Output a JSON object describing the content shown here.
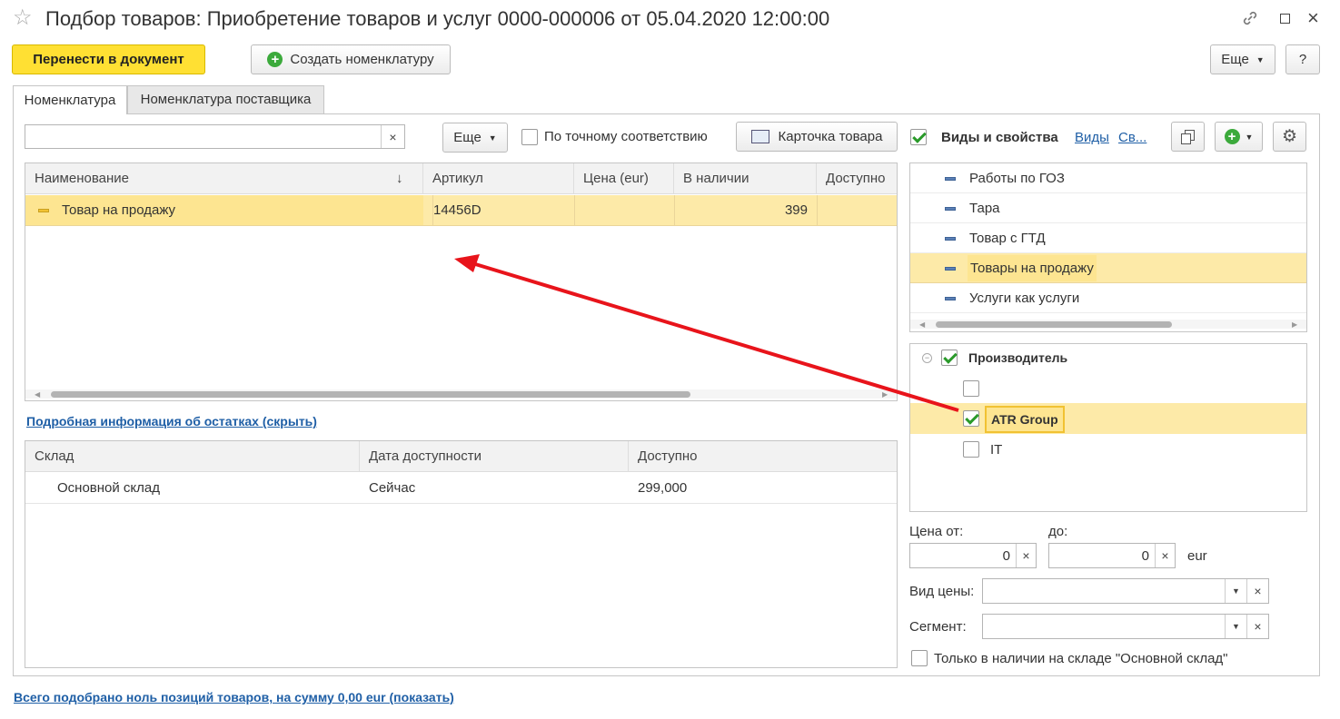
{
  "window": {
    "title": "Подбор товаров: Приобретение товаров и услуг 0000-000006 от 05.04.2020 12:00:00"
  },
  "toolbar": {
    "transfer_label": "Перенести в документ",
    "create_label": "Создать номенклатуру",
    "more_label": "Еще",
    "help_label": "?"
  },
  "tabs": [
    {
      "label": "Номенклатура"
    },
    {
      "label": "Номенклатура поставщика"
    }
  ],
  "search": {
    "value": "",
    "more_label": "Еще",
    "exact_match_label": "По точному соответствию",
    "card_label": "Карточка товара"
  },
  "goods_table": {
    "columns": [
      "Наименование",
      "Артикул",
      "Цена (eur)",
      "В наличии",
      "Доступно"
    ],
    "sort_indicator": "↓",
    "rows": [
      {
        "name": "Товар на продажу",
        "article": "14456D",
        "price": "",
        "in_stock": "399",
        "available": ""
      }
    ]
  },
  "stock_link": "Подробная информация об остатках (скрыть)",
  "stock_table": {
    "columns": [
      "Склад",
      "Дата доступности",
      "Доступно"
    ],
    "rows": [
      {
        "warehouse": "Основной склад",
        "date": "Сейчас",
        "available": "299,000"
      }
    ]
  },
  "filters": {
    "title": "Виды и свойства",
    "link_types": "Виды",
    "link_props": "Св...",
    "kinds": [
      {
        "label": "Работы по ГОЗ"
      },
      {
        "label": "Тара"
      },
      {
        "label": "Товар с ГТД"
      },
      {
        "label": "Товары на продажу"
      },
      {
        "label": "Услуги как услуги"
      }
    ],
    "property": {
      "label": "Производитель",
      "values": [
        {
          "label": ""
        },
        {
          "label": "ATR Group"
        },
        {
          "label": "IT"
        }
      ]
    },
    "price_from_label": "Цена от:",
    "price_to_label": "до:",
    "price_from": "0",
    "price_to": "0",
    "currency": "eur",
    "price_type_label": "Вид цены:",
    "segment_label": "Сегмент:",
    "in_stock_label": "Только в наличии на складе \"Основной склад\""
  },
  "footer": {
    "summary": "Всего подобрано ноль позиций товаров, на сумму 0,00 eur (показать)"
  },
  "colors": {
    "accent_yellow": "#ffe033",
    "row_highlight": "#fdeaa8",
    "annotation_arrow": "#e8141b"
  }
}
